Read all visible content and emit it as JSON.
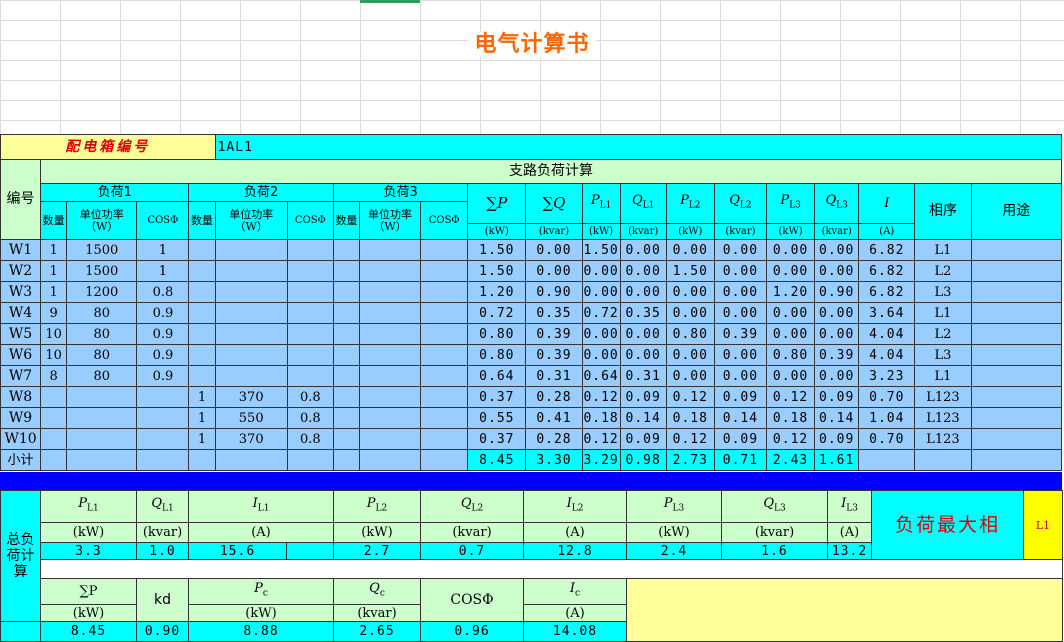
{
  "title": "电气计算书",
  "box_label": "配电箱编号",
  "box_id": "1AL1",
  "branch_title": "支路负荷计算",
  "hdr": {
    "no": "编号",
    "load1": "负荷1",
    "load2": "负荷2",
    "load3": "负荷3",
    "qty": "数量",
    "unit_power": "单位功率（W）",
    "cos": "COSΦ",
    "sum_p": "∑P",
    "sum_q": "∑Q",
    "p": "P",
    "q": "Q",
    "i": "I",
    "sub_l1": "L1",
    "sub_l2": "L2",
    "sub_l3": "L3",
    "phase": "相序",
    "usage": "用途",
    "kw": "(kW)",
    "kvar": "(kvar)",
    "a": "(A)"
  },
  "rows": [
    {
      "no": "W1",
      "q1": "1",
      "w1": "1500",
      "c1": "1",
      "q2": "",
      "w2": "",
      "c2": "",
      "q3": "",
      "w3": "",
      "c3": "",
      "sp": "1.50",
      "sq": "0.00",
      "pl1": "1.50",
      "ql1": "0.00",
      "pl2": "0.00",
      "ql2": "0.00",
      "pl3": "0.00",
      "ql3": "0.00",
      "i": "6.82",
      "ph": "L1",
      "use": ""
    },
    {
      "no": "W2",
      "q1": "1",
      "w1": "1500",
      "c1": "1",
      "q2": "",
      "w2": "",
      "c2": "",
      "q3": "",
      "w3": "",
      "c3": "",
      "sp": "1.50",
      "sq": "0.00",
      "pl1": "0.00",
      "ql1": "0.00",
      "pl2": "1.50",
      "ql2": "0.00",
      "pl3": "0.00",
      "ql3": "0.00",
      "i": "6.82",
      "ph": "L2",
      "use": ""
    },
    {
      "no": "W3",
      "q1": "1",
      "w1": "1200",
      "c1": "0.8",
      "q2": "",
      "w2": "",
      "c2": "",
      "q3": "",
      "w3": "",
      "c3": "",
      "sp": "1.20",
      "sq": "0.90",
      "pl1": "0.00",
      "ql1": "0.00",
      "pl2": "0.00",
      "ql2": "0.00",
      "pl3": "1.20",
      "ql3": "0.90",
      "i": "6.82",
      "ph": "L3",
      "use": ""
    },
    {
      "no": "W4",
      "q1": "9",
      "w1": "80",
      "c1": "0.9",
      "q2": "",
      "w2": "",
      "c2": "",
      "q3": "",
      "w3": "",
      "c3": "",
      "sp": "0.72",
      "sq": "0.35",
      "pl1": "0.72",
      "ql1": "0.35",
      "pl2": "0.00",
      "ql2": "0.00",
      "pl3": "0.00",
      "ql3": "0.00",
      "i": "3.64",
      "ph": "L1",
      "use": ""
    },
    {
      "no": "W5",
      "q1": "10",
      "w1": "80",
      "c1": "0.9",
      "q2": "",
      "w2": "",
      "c2": "",
      "q3": "",
      "w3": "",
      "c3": "",
      "sp": "0.80",
      "sq": "0.39",
      "pl1": "0.00",
      "ql1": "0.00",
      "pl2": "0.80",
      "ql2": "0.39",
      "pl3": "0.00",
      "ql3": "0.00",
      "i": "4.04",
      "ph": "L2",
      "use": ""
    },
    {
      "no": "W6",
      "q1": "10",
      "w1": "80",
      "c1": "0.9",
      "q2": "",
      "w2": "",
      "c2": "",
      "q3": "",
      "w3": "",
      "c3": "",
      "sp": "0.80",
      "sq": "0.39",
      "pl1": "0.00",
      "ql1": "0.00",
      "pl2": "0.00",
      "ql2": "0.00",
      "pl3": "0.80",
      "ql3": "0.39",
      "i": "4.04",
      "ph": "L3",
      "use": ""
    },
    {
      "no": "W7",
      "q1": "8",
      "w1": "80",
      "c1": "0.9",
      "q2": "",
      "w2": "",
      "c2": "",
      "q3": "",
      "w3": "",
      "c3": "",
      "sp": "0.64",
      "sq": "0.31",
      "pl1": "0.64",
      "ql1": "0.31",
      "pl2": "0.00",
      "ql2": "0.00",
      "pl3": "0.00",
      "ql3": "0.00",
      "i": "3.23",
      "ph": "L1",
      "use": ""
    },
    {
      "no": "W8",
      "q1": "",
      "w1": "",
      "c1": "",
      "q2": "1",
      "w2": "370",
      "c2": "0.8",
      "q3": "",
      "w3": "",
      "c3": "",
      "sp": "0.37",
      "sq": "0.28",
      "pl1": "0.12",
      "ql1": "0.09",
      "pl2": "0.12",
      "ql2": "0.09",
      "pl3": "0.12",
      "ql3": "0.09",
      "i": "0.70",
      "ph": "L123",
      "use": ""
    },
    {
      "no": "W9",
      "q1": "",
      "w1": "",
      "c1": "",
      "q2": "1",
      "w2": "550",
      "c2": "0.8",
      "q3": "",
      "w3": "",
      "c3": "",
      "sp": "0.55",
      "sq": "0.41",
      "pl1": "0.18",
      "ql1": "0.14",
      "pl2": "0.18",
      "ql2": "0.14",
      "pl3": "0.18",
      "ql3": "0.14",
      "i": "1.04",
      "ph": "L123",
      "use": ""
    },
    {
      "no": "W10",
      "q1": "",
      "w1": "",
      "c1": "",
      "q2": "1",
      "w2": "370",
      "c2": "0.8",
      "q3": "",
      "w3": "",
      "c3": "",
      "sp": "0.37",
      "sq": "0.28",
      "pl1": "0.12",
      "ql1": "0.09",
      "pl2": "0.12",
      "ql2": "0.09",
      "pl3": "0.12",
      "ql3": "0.09",
      "i": "0.70",
      "ph": "L123",
      "use": ""
    }
  ],
  "subtotal": {
    "label": "小计",
    "sp": "8.45",
    "sq": "3.30",
    "pl1": "3.29",
    "ql1": "0.98",
    "pl2": "2.73",
    "ql2": "0.71",
    "pl3": "2.43",
    "ql3": "1.61"
  },
  "total": {
    "label": "总负荷计算",
    "pl1": "3.3",
    "ql1": "1.0",
    "il1": "15.6",
    "pl2": "2.7",
    "ql2": "0.7",
    "il2": "12.8",
    "pl3": "2.4",
    "ql3": "1.6",
    "il3": "13.2",
    "max_phase_label": "负荷最大相",
    "max_phase": "L1",
    "kd_label": "kd",
    "pc": "P",
    "qc": "Q",
    "ic": "I",
    "sub_c": "c",
    "sum_p": "∑P",
    "sum_p_val": "8.45",
    "kd": "0.90",
    "pc_val": "8.88",
    "qc_val": "2.65",
    "cos_val": "0.96",
    "ic_val": "14.08"
  }
}
